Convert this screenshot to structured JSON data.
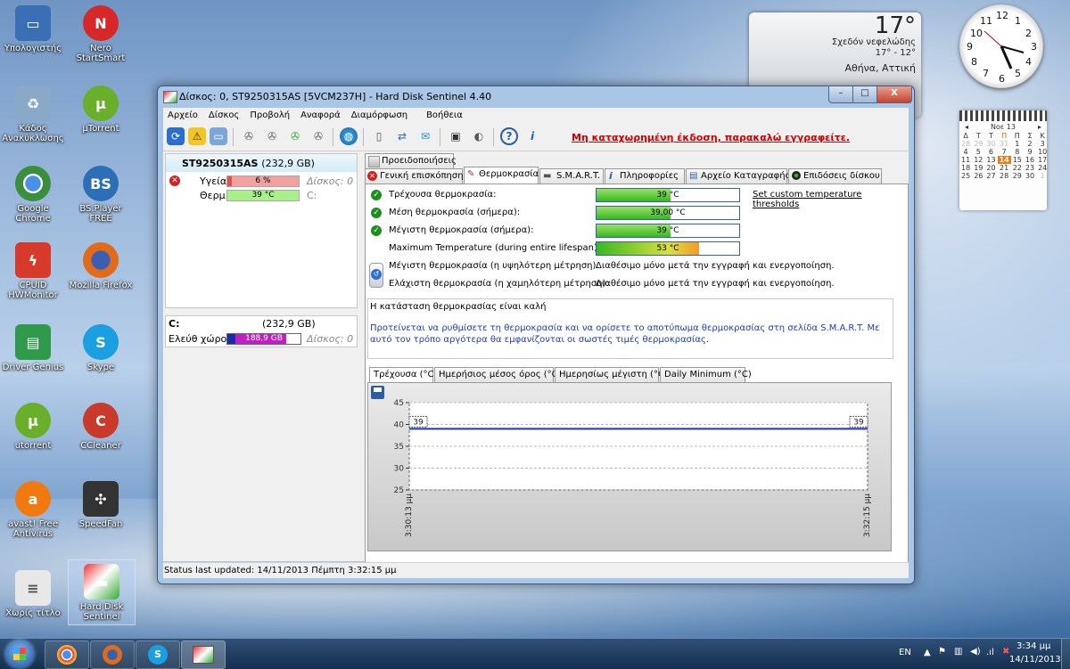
{
  "desktop": {
    "icons": [
      {
        "label": "Υπολογιστής",
        "glyph": "computer-icon",
        "color": "#3a6fb5"
      },
      {
        "label": "Nero StartSmart",
        "glyph": "nero-icon",
        "color": "#d62828"
      },
      {
        "label": "Κάδος Ανακύκλωσης",
        "glyph": "recycle-bin-icon",
        "color": "#8aa9c9"
      },
      {
        "label": "µTorrent",
        "glyph": "utorrent-icon",
        "color": "#6aaf2a"
      },
      {
        "label": "Google Chrome",
        "glyph": "chrome-icon",
        "color": "#3b8e3b"
      },
      {
        "label": "BS.Player FREE",
        "glyph": "bsplayer-icon",
        "color": "#2c6fb7"
      },
      {
        "label": "CPUID HWMonitor",
        "glyph": "cpuid-icon",
        "color": "#d73a2a"
      },
      {
        "label": "Mozilla Firefox",
        "glyph": "firefox-icon",
        "color": "#e06b1a"
      },
      {
        "label": "Driver Genius",
        "glyph": "driver-genius-icon",
        "color": "#2e9a4a"
      },
      {
        "label": "Skype",
        "glyph": "skype-icon",
        "color": "#1aa0e0"
      },
      {
        "label": "utorrent",
        "glyph": "utorrent-icon",
        "color": "#6aaf2a"
      },
      {
        "label": "CCleaner",
        "glyph": "ccleaner-icon",
        "color": "#c93a2a"
      },
      {
        "label": "avast! Free Antivirus",
        "glyph": "avast-icon",
        "color": "#f07a10"
      },
      {
        "label": "SpeedFan",
        "glyph": "speedfan-icon",
        "color": "#333333"
      },
      {
        "label": "Χωρίς τίτλο",
        "glyph": "document-icon",
        "color": "#e8e8e8"
      },
      {
        "label": "Hard Disk Sentinel",
        "glyph": "hard-disk-sentinel-icon",
        "color": "#999999"
      }
    ],
    "weather": {
      "temp": "17°",
      "desc": "Σχεδόν νεφελώδης",
      "range": "17° - 12°",
      "location": "Αθήνα, Αττική"
    },
    "clock": {
      "numbers": [
        "12",
        "1",
        "2",
        "3",
        "4",
        "5",
        "6",
        "7",
        "8",
        "9",
        "10",
        "11"
      ]
    },
    "calendar": {
      "month": "Νοε 13",
      "days": [
        "Δ",
        "Τ",
        "Τ",
        "Π",
        "Π",
        "Σ",
        "Κ"
      ],
      "weeks": [
        [
          "28",
          "29",
          "30",
          "31",
          "1",
          "2",
          "3"
        ],
        [
          "4",
          "5",
          "6",
          "7",
          "8",
          "9",
          "10"
        ],
        [
          "11",
          "12",
          "13",
          "14",
          "15",
          "16",
          "17"
        ],
        [
          "18",
          "19",
          "20",
          "21",
          "22",
          "23",
          "24"
        ],
        [
          "25",
          "26",
          "27",
          "28",
          "29",
          "30",
          "1"
        ]
      ],
      "today": "14"
    }
  },
  "window": {
    "title": "Δίσκος: 0, ST9250315AS [5VCM237H]  -  Hard Disk Sentinel 4.40",
    "buttons": {
      "minimize": "–",
      "maximize": "□",
      "close": "X"
    },
    "menu": [
      "Αρχείο",
      "Δίσκος",
      "Προβολή",
      "Αναφορά",
      "Διαμόρφωση",
      "Βοήθεια"
    ],
    "toolbar": {
      "icons": [
        "refresh-icon",
        "warning-icon",
        "disk-info-icon",
        "satellite-1-icon",
        "satellite-2-icon",
        "satellite-3-icon",
        "satellite-4-icon",
        "network-icon",
        "report-icon",
        "sync-icon",
        "send-icon",
        "monitor-icon",
        "speaker-icon",
        "help-icon",
        "info-icon"
      ],
      "register_text": "Μη καταχωρημένη έκδοση, παρακαλώ εγγραφείτε."
    },
    "disk": {
      "name": "ST9250315AS",
      "size": "(232,9 GB)",
      "health_label": "Υγεία:",
      "health_value": "6 %",
      "health_fraction": 0.06,
      "temp_label": "Θερμ.:",
      "temp_value": "39 °C",
      "disk_label": "Δίσκος: 0",
      "drive_letter": "C:"
    },
    "volume": {
      "letter": "C:",
      "size": "(232,9 GB)",
      "free_label": "Ελεύθ χώρος",
      "free_value": "188,9 GB",
      "free_fraction": 0.81,
      "disk_label": "Δίσκος: 0"
    },
    "tabs_top": [
      "Προειδοποιήσεις"
    ],
    "tabs": [
      "Γενική επισκόπηση",
      "Θερμοκρασία",
      "S.M.A.R.T.",
      "Πληροφορίες",
      "Αρχείο Καταγραφής",
      "Επιδόσεις δίσκου"
    ],
    "temperature": {
      "rows": [
        {
          "label": "Τρέχουσα θερμοκρασία:",
          "value": "39 °C",
          "fraction": 0.52
        },
        {
          "label": "Μέση θερμοκρασία (σήμερα):",
          "value": "39,00 °C",
          "fraction": 0.52
        },
        {
          "label": "Μέγιστη θερμοκρασία (σήμερα):",
          "value": "39 °C",
          "fraction": 0.52
        },
        {
          "label": "Maximum Temperature (during entire lifespan):",
          "value": "53 °C",
          "fraction": 0.72
        }
      ],
      "threshold_link": "Set custom temperature thresholds",
      "max_measured_label": "Μέγιστη θερμοκρασία (η υψηλότερη μέτρηση):",
      "max_measured_value": "Διαθέσιμο μόνο μετά την εγγραφή και ενεργοποίηση.",
      "min_measured_label": "Ελάχιστη θερμοκρασία (η χαμηλότερη μέτρηση):",
      "min_measured_value": "Διαθέσιμο μόνο μετά την εγγραφή και ενεργοποίηση.",
      "status_title": "Η κατάσταση θερμοκρασίας είναι καλή",
      "status_text": "Προτείνεται να ρυθμίσετε τη θερμοκρασία και να ορίσετε το αποτύπωμα θερμοκρασίας στη σελίδα S.M.A.R.T. Με αυτό τον τρόπο αργότερα θα εμφανίζονται οι σωστές τιμές θερμοκρασίας."
    },
    "graph_tabs": [
      "Τρέχουσα (°C)",
      "Ημερήσιος μέσος όρος (°C)",
      "Ημερησίως μέγιστη (°C)",
      "Daily Minimum (°C)"
    ],
    "graph": {
      "y_ticks": [
        "45",
        "40",
        "35",
        "30",
        "25"
      ],
      "x_labels": [
        "3:30:13 μμ",
        "3:32:15 μμ"
      ],
      "point_labels": [
        "39",
        "39"
      ]
    },
    "status": "Status last updated: 14/11/2013 Πέμπτη 3:32:15 μμ"
  },
  "chart_data": {
    "type": "line",
    "x": [
      "3:30:13 μμ",
      "3:32:15 μμ"
    ],
    "series": [
      {
        "values": [
          39,
          39
        ]
      }
    ],
    "ylim": [
      25,
      45
    ],
    "yticks": [
      25,
      30,
      35,
      40,
      45
    ],
    "grid": true
  },
  "taskbar": {
    "apps": [
      "chrome-icon",
      "firefox-icon",
      "skype-icon",
      "hard-disk-sentinel-icon"
    ],
    "lang": "EN",
    "time": "3:34 μμ",
    "date": "14/11/2013"
  }
}
